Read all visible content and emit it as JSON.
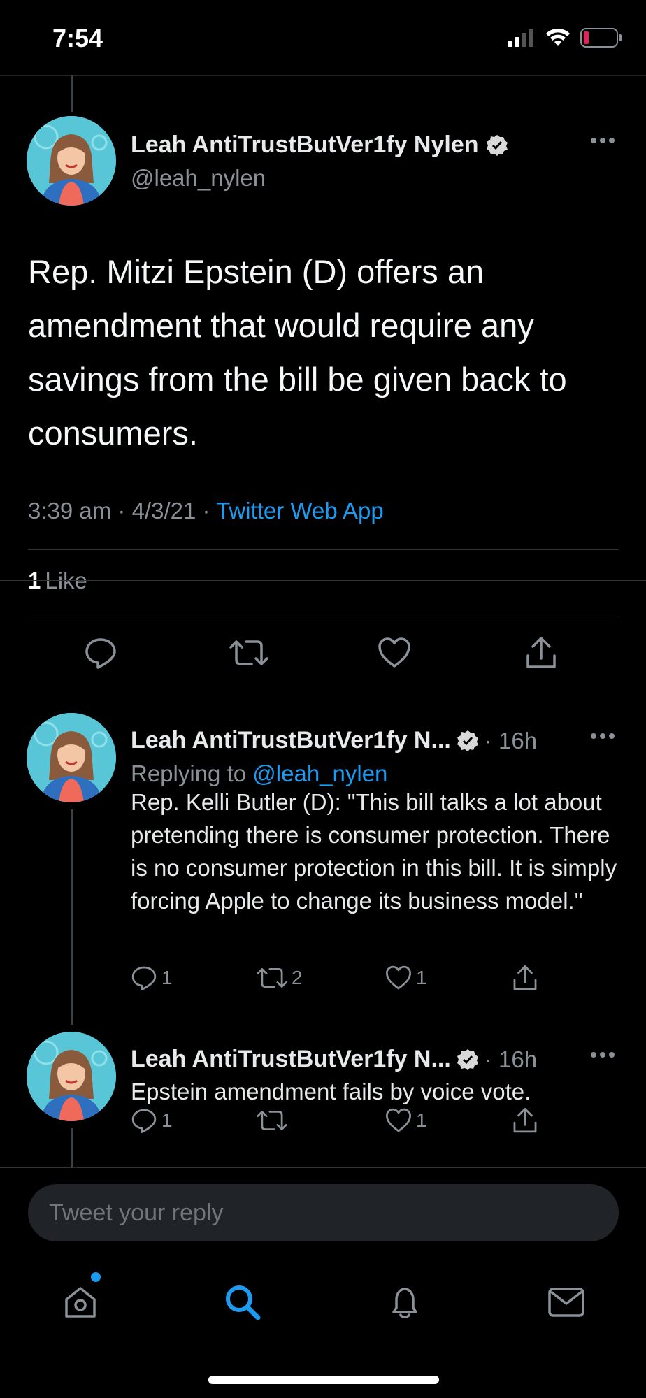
{
  "status_bar": {
    "time": "7:54"
  },
  "main_tweet": {
    "display_name": "Leah AntiTrustButVer1fy Nylen",
    "handle": "@leah_nylen",
    "text": "Rep. Mitzi Epstein (D) offers an amendment that would require any savings from the bill be given back to consumers.",
    "time": "3:39 am",
    "date": "4/3/21",
    "source": "Twitter Web App",
    "like_count": "1",
    "like_label": "Like"
  },
  "replies": [
    {
      "display_name": "Leah AntiTrustButVer1fy N...",
      "time_ago": "· 16h",
      "replying_label": "Replying to",
      "replying_to": "@leah_nylen",
      "text": "Rep. Kelli Butler (D): \"This bill talks a lot about pretending there is consumer protection. There is no consumer protection in this bill. It is simply forcing Apple to change its business model.\"",
      "reply_count": "1",
      "retweet_count": "2",
      "like_count": "1"
    },
    {
      "display_name": "Leah AntiTrustButVer1fy N...",
      "time_ago": "· 16h",
      "text": "Epstein amendment fails by voice vote.",
      "reply_count": "1",
      "retweet_count": "",
      "like_count": "1"
    }
  ],
  "composer": {
    "placeholder": "Tweet your reply"
  },
  "tabs": [
    "home-icon",
    "search-icon",
    "notifications-icon",
    "messages-icon"
  ],
  "colors": {
    "accent": "#1d9bf0",
    "muted": "#8b9198",
    "background": "#000000",
    "battery_low": "#e0245e"
  }
}
